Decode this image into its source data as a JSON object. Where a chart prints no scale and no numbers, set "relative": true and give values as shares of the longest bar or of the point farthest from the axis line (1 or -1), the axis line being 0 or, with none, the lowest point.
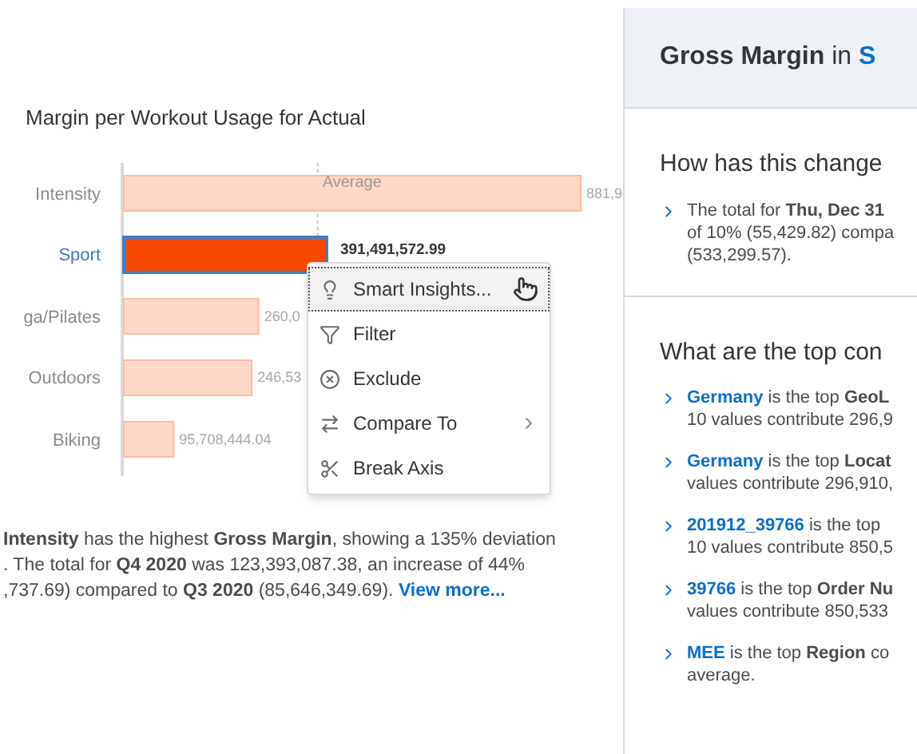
{
  "chart": {
    "title": "Margin per Workout Usage for Actual",
    "chart_data": {
      "type": "bar",
      "orientation": "horizontal",
      "relative": true,
      "categories": [
        "Intensity",
        "Sport",
        "ga/Pilates",
        "Outdoors",
        "Biking"
      ],
      "values": [
        1,
        0.444,
        0.295,
        0.28,
        0.109
      ],
      "ref_lines": [
        {
          "axis": "x",
          "value": 0.426,
          "label": "Average"
        }
      ]
    },
    "bars": [
      {
        "selected": false,
        "label": "881,9"
      },
      {
        "selected": true,
        "label": "391,491,572.99"
      },
      {
        "selected": false,
        "label": "260,0"
      },
      {
        "selected": false,
        "label": "246,53"
      },
      {
        "selected": false,
        "label": "95,708,444.04"
      }
    ]
  },
  "context_menu": {
    "items": [
      {
        "label": "Smart Insights...",
        "kind": "bulb",
        "selected": true,
        "submenu": false
      },
      {
        "label": "Filter",
        "kind": "filter",
        "selected": false,
        "submenu": false
      },
      {
        "label": "Exclude",
        "kind": "exclude",
        "selected": false,
        "submenu": false
      },
      {
        "label": "Compare To",
        "kind": "compare",
        "selected": false,
        "submenu": true
      },
      {
        "label": "Break Axis",
        "kind": "break",
        "selected": false,
        "submenu": false
      }
    ]
  },
  "summary": {
    "lines": [
      "**Intensity** has the highest **Gross Margin**, showing a 135% deviation",
      ". The total for **Q4 2020** was 123,393,087.38, an increase of 44%",
      ",737.69) compared to **Q3 2020** (85,646,349.69). "
    ],
    "link": "View more..."
  },
  "panel": {
    "title": {
      "measure": "Gross Margin",
      "connector": "in",
      "dimension": "S"
    },
    "sections": [
      {
        "heading": "How has this change",
        "items": [
          {
            "lines": [
              "The total for **Thu, Dec 31**",
              "of 10% (55,429.82) compa",
              "(533,299.57)."
            ]
          }
        ]
      },
      {
        "heading": "What are the top con",
        "items": [
          {
            "link": "Germany",
            "lines": [
              " is the top **GeoL**",
              "10 values contribute 296,9"
            ]
          },
          {
            "link": "Germany",
            "lines": [
              " is the top **Locat**",
              "values contribute 296,910,"
            ]
          },
          {
            "link": "201912_39766",
            "lines": [
              " is the top",
              "10 values contribute 850,5"
            ]
          },
          {
            "link": "39766",
            "lines": [
              " is the top **Order Nu**",
              "values contribute 850,533"
            ]
          },
          {
            "link": "MEE",
            "lines": [
              " is the top **Region** co",
              "average."
            ]
          }
        ]
      }
    ]
  }
}
